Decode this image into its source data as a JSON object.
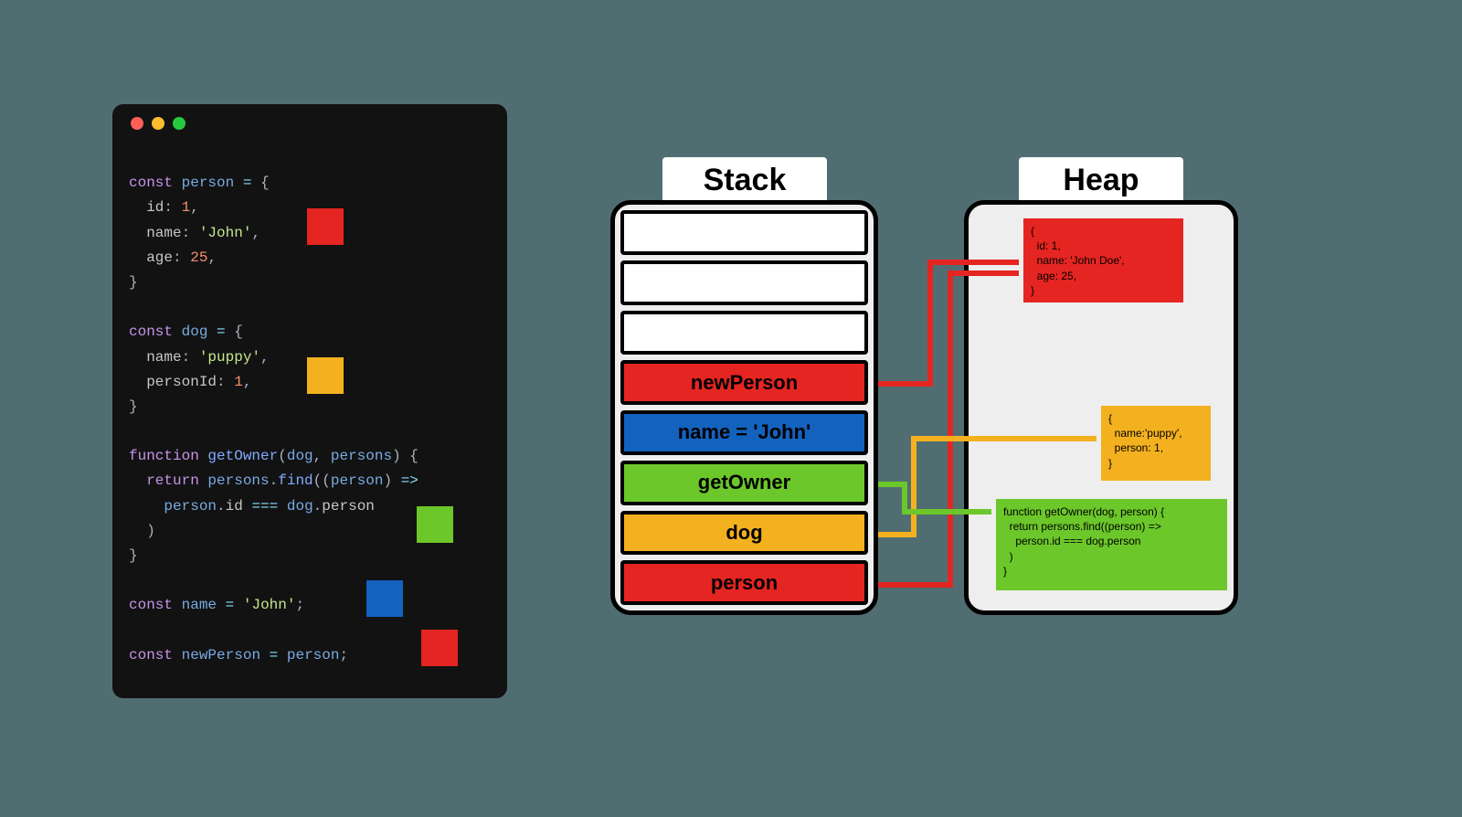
{
  "code_lines": {
    "l1": "const person = {",
    "l2": "  id: 1,",
    "l3": "  name: 'John',",
    "l4": "  age: 25,",
    "l5": "}",
    "l6": "",
    "l7": "const dog = {",
    "l8": "  name: 'puppy',",
    "l9": "  personId: 1,",
    "l10": "}",
    "l11": "",
    "l12": "function getOwner(dog, persons) {",
    "l13": "  return persons.find((person) =>",
    "l14": "    person.id === dog.person",
    "l15": "  )",
    "l16": "}",
    "l17": "",
    "l18": "const name = 'John';",
    "l19": "",
    "l20": "const newPerson = person;"
  },
  "markers": {
    "red1_color": "#e52521",
    "orange_color": "#f3b11f",
    "green_color": "#6cc72a",
    "blue_color": "#1362be",
    "red2_color": "#e52521"
  },
  "titles": {
    "stack": "Stack",
    "heap": "Heap"
  },
  "stack": {
    "rows": {
      "r0": "",
      "r1": "",
      "r2": "",
      "r3": "newPerson",
      "r4": "name = 'John'",
      "r5": "getOwner",
      "r6": "dog",
      "r7": "person"
    }
  },
  "heap": {
    "person_obj": "{\n  id: 1,\n  name: 'John Doe',\n  age: 25,\n}",
    "dog_obj": "{\n  name:'puppy',\n  person: 1,\n}",
    "getOwner_obj": "function getOwner(dog, person) {\n  return persons.find((person) =>\n    person.id === dog.person\n  )\n}"
  },
  "colors": {
    "red": "#e52521",
    "orange": "#f3b11f",
    "green": "#6cc72a",
    "blue": "#1362be"
  }
}
